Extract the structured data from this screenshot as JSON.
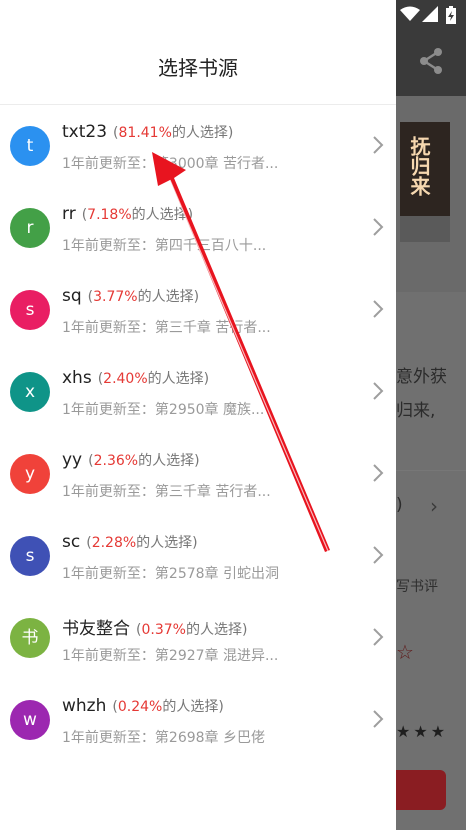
{
  "drawer": {
    "title": "选择书源",
    "items": [
      {
        "letter": "t",
        "name": "txt23",
        "pct": "81.41%",
        "pct_suffix": "的人选择)",
        "update": "1年前更新至：第3000章 苦行者...",
        "color": "#2b91f0"
      },
      {
        "letter": "r",
        "name": "rr",
        "pct": "7.18%",
        "pct_suffix": "的人选择)",
        "update": "1年前更新至：第四千三百八十...",
        "color": "#43a047"
      },
      {
        "letter": "s",
        "name": "sq",
        "pct": "3.77%",
        "pct_suffix": "的人选择)",
        "update": "1年前更新至：第三千章 苦行者...",
        "color": "#e91e63"
      },
      {
        "letter": "x",
        "name": "xhs",
        "pct": "2.40%",
        "pct_suffix": "的人选择)",
        "update": "1年前更新至：第2950章 魔族...",
        "color": "#0f9488"
      },
      {
        "letter": "y",
        "name": "yy",
        "pct": "2.36%",
        "pct_suffix": "的人选择)",
        "update": "1年前更新至：第三千章 苦行者...",
        "color": "#f0423a"
      },
      {
        "letter": "s",
        "name": "sc",
        "pct": "2.28%",
        "pct_suffix": "的人选择)",
        "update": "1年前更新至：第2578章 引蛇出洞",
        "color": "#3f51b5"
      },
      {
        "letter": "书",
        "name": "书友整合",
        "pct": "0.37%",
        "pct_suffix": "的人选择)",
        "update": "1年前更新至：第2927章 混进异...",
        "color": "#7cb342"
      },
      {
        "letter": "w",
        "name": "whzh",
        "pct": "0.24%",
        "pct_suffix": "的人选择)",
        "update": "1年前更新至：第2698章 乡巴佬",
        "color": "#9c27b0"
      }
    ]
  },
  "background": {
    "cover_title": "抚归来",
    "text_line1": "意外获",
    "text_line2": "归来,",
    "paren": ")",
    "write_review": "写书评",
    "stars": "★★★"
  },
  "icons": {
    "share": "share-icon",
    "wifi": "wifi-icon",
    "signal": "signal-icon",
    "battery": "battery-icon",
    "chevron": "chevron-right-icon"
  },
  "annotation_color": "#e8141f"
}
